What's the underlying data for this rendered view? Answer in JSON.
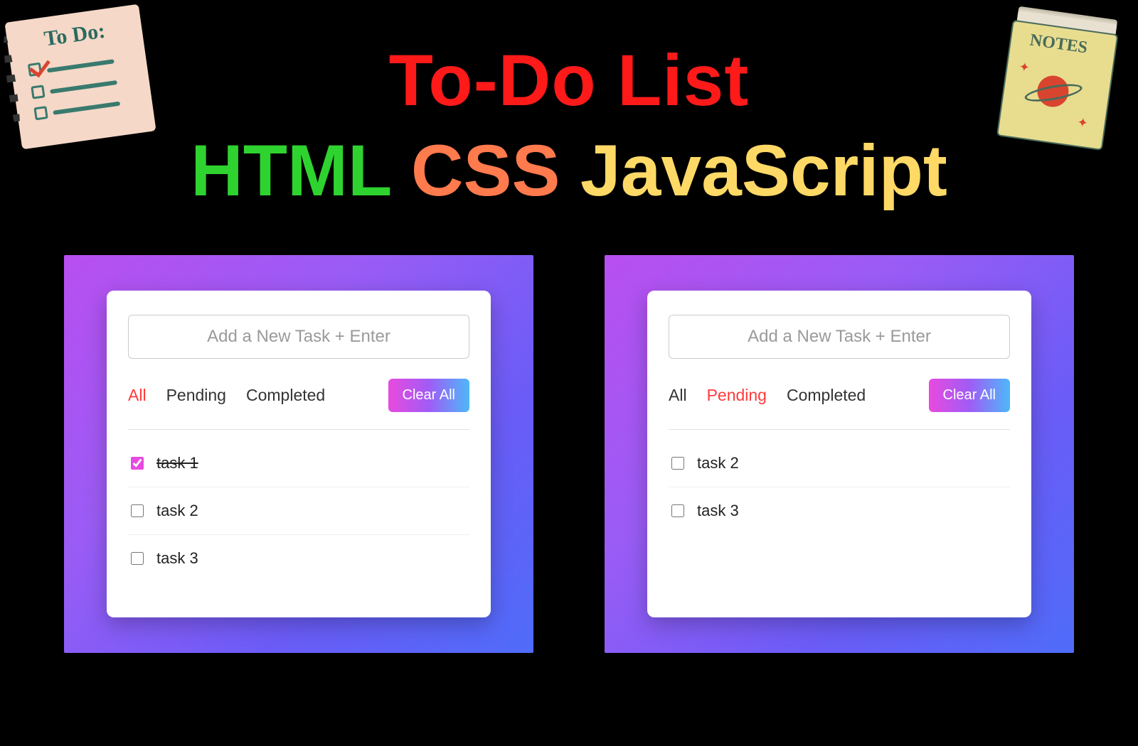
{
  "title": {
    "main": "To-Do List",
    "html": "HTML",
    "css": "CSS",
    "js": "JavaScript"
  },
  "deco": {
    "todo_label": "To Do:",
    "notes_label": "NOTES"
  },
  "app_left": {
    "input_placeholder": "Add a New Task + Enter",
    "filters": {
      "all": "All",
      "pending": "Pending",
      "completed": "Completed"
    },
    "active_filter": "all",
    "clear_label": "Clear All",
    "tasks": [
      {
        "label": "task 1",
        "done": true
      },
      {
        "label": "task 2",
        "done": false
      },
      {
        "label": "task 3",
        "done": false
      }
    ]
  },
  "app_right": {
    "input_placeholder": "Add a New Task + Enter",
    "filters": {
      "all": "All",
      "pending": "Pending",
      "completed": "Completed"
    },
    "active_filter": "pending",
    "clear_label": "Clear All",
    "tasks": [
      {
        "label": "task 2",
        "done": false
      },
      {
        "label": "task 3",
        "done": false
      }
    ]
  }
}
